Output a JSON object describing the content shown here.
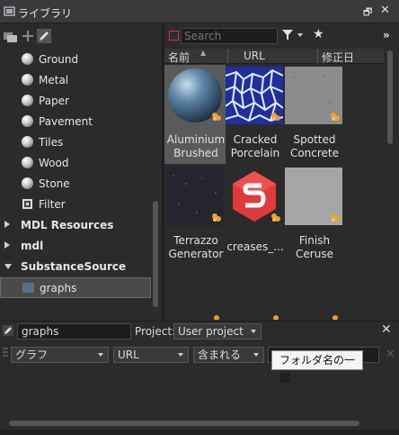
{
  "window": {
    "title": "ライブラリ"
  },
  "tree": {
    "items": [
      {
        "label": "Ground",
        "kind": "sphere"
      },
      {
        "label": "Metal",
        "kind": "sphere"
      },
      {
        "label": "Paper",
        "kind": "sphere"
      },
      {
        "label": "Pavement",
        "kind": "sphere"
      },
      {
        "label": "Tiles",
        "kind": "sphere"
      },
      {
        "label": "Wood",
        "kind": "sphere"
      },
      {
        "label": "Stone",
        "kind": "sphere"
      },
      {
        "label": "Filter",
        "kind": "filter"
      },
      {
        "label": "MDL Resources",
        "kind": "group-collapsed"
      },
      {
        "label": "mdl",
        "kind": "group-collapsed"
      },
      {
        "label": "SubstanceSource",
        "kind": "group-expanded"
      },
      {
        "label": "graphs",
        "kind": "folder-selected"
      }
    ]
  },
  "search": {
    "placeholder": "Search"
  },
  "columns": {
    "name": "名前",
    "url": "URL",
    "modified": "修正日"
  },
  "assets": [
    {
      "line1": "Aluminium",
      "line2": "Brushed",
      "selected": true
    },
    {
      "line1": "Cracked",
      "line2": "Porcelain",
      "selected": false
    },
    {
      "line1": "Spotted",
      "line2": "Concrete",
      "selected": false
    },
    {
      "line1": "Terrazzo",
      "line2": "Generator",
      "selected": false
    },
    {
      "line1": "creases_...",
      "line2": "",
      "selected": false
    },
    {
      "line1": "Finish",
      "line2": "Ceruse",
      "selected": false
    }
  ],
  "bottom": {
    "folder_value": "graphs",
    "project_label": "Project:",
    "project_value": "User project"
  },
  "filter": {
    "field": "グラフ",
    "type": "URL",
    "op": "含まれる",
    "tooltip": "フォルダ名の一部"
  },
  "colors": {
    "accent": "#e84545",
    "badge": "#f0a030"
  }
}
